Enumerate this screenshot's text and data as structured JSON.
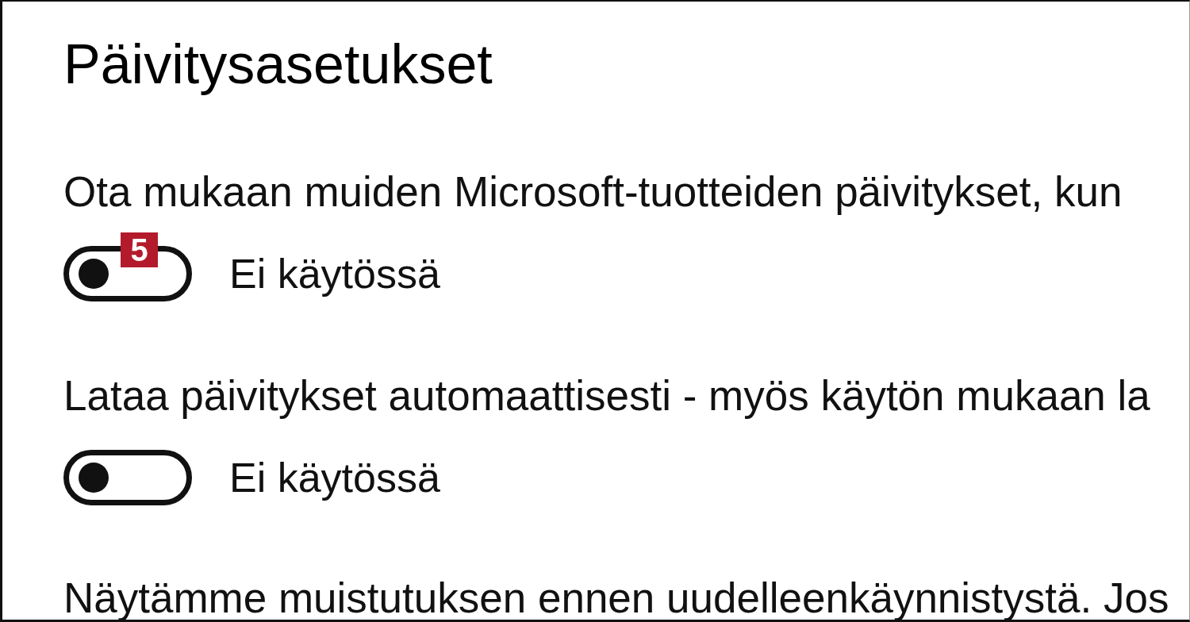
{
  "page": {
    "title": "Päivitysasetukset"
  },
  "settings": [
    {
      "kind": "toggle",
      "description": "Ota mukaan muiden Microsoft-tuotteiden päivitykset, kun",
      "on": false,
      "state_label": "Ei käytössä",
      "badge": "5"
    },
    {
      "kind": "toggle",
      "description": "Lataa päivitykset automaattisesti - myös käytön mukaan la",
      "on": false,
      "state_label": "Ei käytössä"
    },
    {
      "kind": "text",
      "description": "Näytämme muistutuksen ennen uudelleenkäynnistystä. Jos"
    }
  ]
}
